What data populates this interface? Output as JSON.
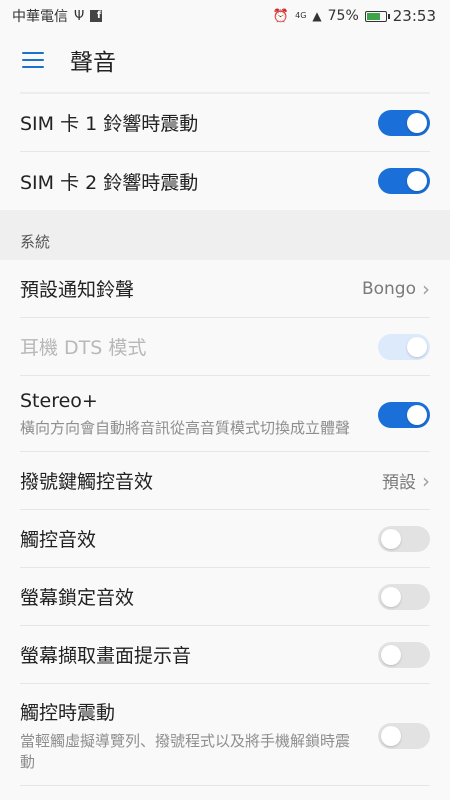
{
  "status_bar": {
    "carrier": "中華電信",
    "usb_symbol": "Ψ",
    "fb_symbol": "f",
    "alarm_symbol": "⏰",
    "network": "4G",
    "signal_symbol": "▲",
    "battery": "75%",
    "battery_level": 0.75,
    "time": "23:53"
  },
  "header": {
    "title": "聲音"
  },
  "rows_top": [
    {
      "label": "SIM 卡 1 鈴響時震動",
      "switch": "on"
    },
    {
      "label": "SIM 卡 2 鈴響時震動",
      "switch": "on"
    }
  ],
  "section": {
    "title": "系統"
  },
  "rows": [
    {
      "label": "預設通知鈴聲",
      "value": "Bongo",
      "chevron": "›"
    },
    {
      "label": "耳機 DTS 模式",
      "switch": "on-disabled"
    },
    {
      "label": "Stereo+",
      "desc": "橫向方向會自動將音訊從高音質模式切換成立體聲",
      "switch": "on"
    },
    {
      "label": "撥號鍵觸控音效",
      "value": "預設",
      "chevron": "›"
    },
    {
      "label": "觸控音效",
      "switch": "off"
    },
    {
      "label": "螢幕鎖定音效",
      "switch": "off"
    },
    {
      "label": "螢幕擷取畫面提示音",
      "switch": "off"
    },
    {
      "label": "觸控時震動",
      "desc": "當輕觸虛擬導覽列、撥號程式以及將手機解鎖時震動",
      "switch": "off"
    }
  ],
  "colors": {
    "accent": "#1a6fd8",
    "switch_off": "#e2e2e2",
    "battery": "#3ea44a"
  }
}
